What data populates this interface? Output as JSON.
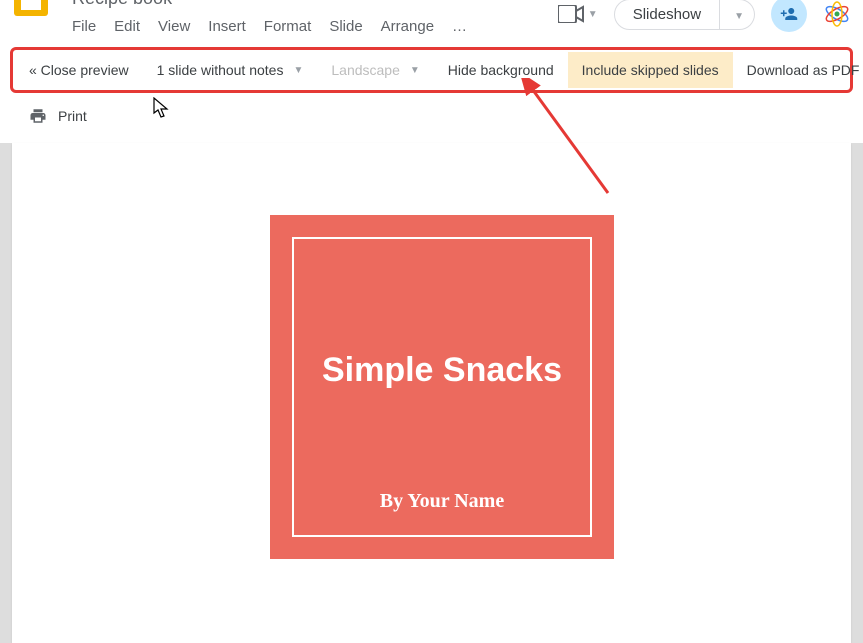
{
  "header": {
    "doc_title": "Recipe book",
    "menus": [
      "File",
      "Edit",
      "View",
      "Insert",
      "Format",
      "Slide",
      "Arrange",
      "…"
    ],
    "slideshow_label": "Slideshow"
  },
  "preview_toolbar": {
    "close": "« Close preview",
    "slides_per_page": "1 slide without notes",
    "orientation": "Landscape",
    "hide_bg": "Hide background",
    "include_skipped": "Include skipped slides",
    "download_pdf": "Download as PDF"
  },
  "print_row": {
    "print_label": "Print"
  },
  "slide": {
    "title": "Simple Snacks",
    "subtitle": "By Your Name"
  },
  "colors": {
    "highlight_border": "#e53935",
    "slide_bg": "#ec6a5e",
    "toolbar_highlight_bg": "#fdecc8"
  }
}
